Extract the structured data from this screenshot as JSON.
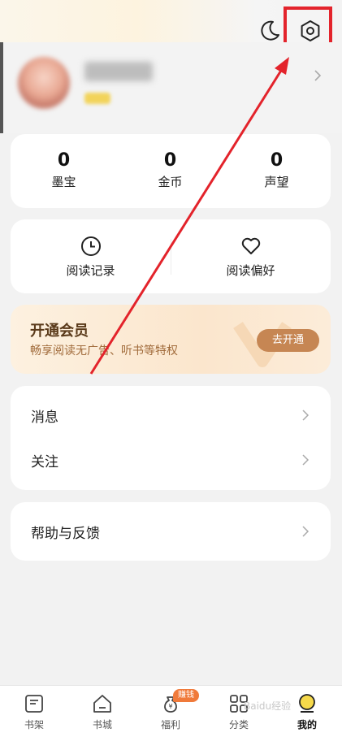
{
  "stats": [
    {
      "value": "0",
      "label": "墨宝"
    },
    {
      "value": "0",
      "label": "金币"
    },
    {
      "value": "0",
      "label": "声望"
    }
  ],
  "records": [
    {
      "label": "阅读记录",
      "icon": "clock-icon"
    },
    {
      "label": "阅读偏好",
      "icon": "heart-icon"
    }
  ],
  "vip": {
    "title": "开通会员",
    "desc": "畅享阅读无广告、听书等特权",
    "button": "去开通"
  },
  "menu": [
    {
      "label": "消息"
    },
    {
      "label": "关注"
    },
    {
      "label": "帮助与反馈"
    }
  ],
  "tabs": [
    {
      "label": "书架",
      "icon": "bookshelf-icon"
    },
    {
      "label": "书城",
      "icon": "home-icon"
    },
    {
      "label": "福利",
      "icon": "money-bag-icon",
      "badge": "赚钱"
    },
    {
      "label": "分类",
      "icon": "grid-icon"
    },
    {
      "label": "我的",
      "icon": "profile-avatar-icon",
      "active": true
    }
  ],
  "watermark": "Baidu经验",
  "colors": {
    "annotation": "#e3232b",
    "vip_button": "#c68653",
    "badge": "#f07a3a"
  }
}
